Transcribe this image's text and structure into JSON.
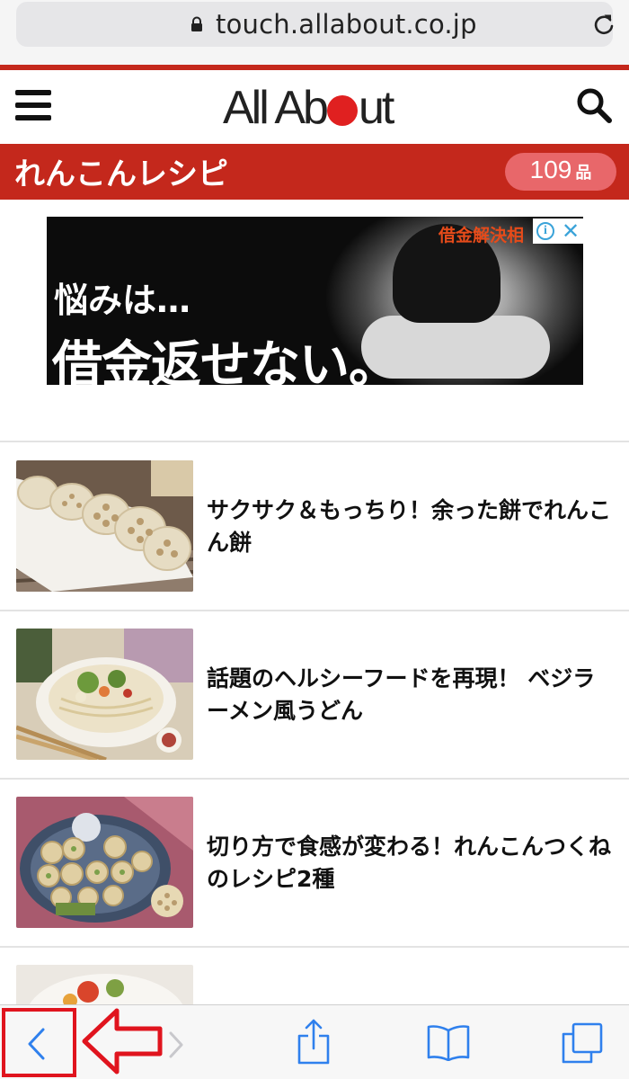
{
  "browser": {
    "url": "touch.allabout.co.jp",
    "lock_icon": "lock-icon",
    "reload_icon": "reload-icon"
  },
  "header": {
    "menu_icon": "hamburger-menu-icon",
    "logo": "All About",
    "search_icon": "search-icon"
  },
  "category": {
    "title": "れんこんレシピ",
    "count": "109",
    "count_unit": "品"
  },
  "ad": {
    "tag": "借金解決相",
    "line1": "悩みは…",
    "line2": "借金返せない。"
  },
  "recipes": [
    {
      "title": "サクサク＆もっちり！余った餅でれんこん餅"
    },
    {
      "title": "話題のヘルシーフードを再現！ ベジラーメン風うどん"
    },
    {
      "title": "切り方で食感が変わる！れんこんつくねのレシピ2種"
    },
    {
      "title": ""
    }
  ],
  "toolbar": {
    "items": [
      "back-icon",
      "forward-icon",
      "share-icon",
      "bookmarks-icon",
      "tabs-icon"
    ]
  },
  "colors": {
    "brand_red": "#c4281c",
    "pill": "#e8676a",
    "ios_blue": "#2f80ed",
    "annotation_red": "#e0141e"
  }
}
